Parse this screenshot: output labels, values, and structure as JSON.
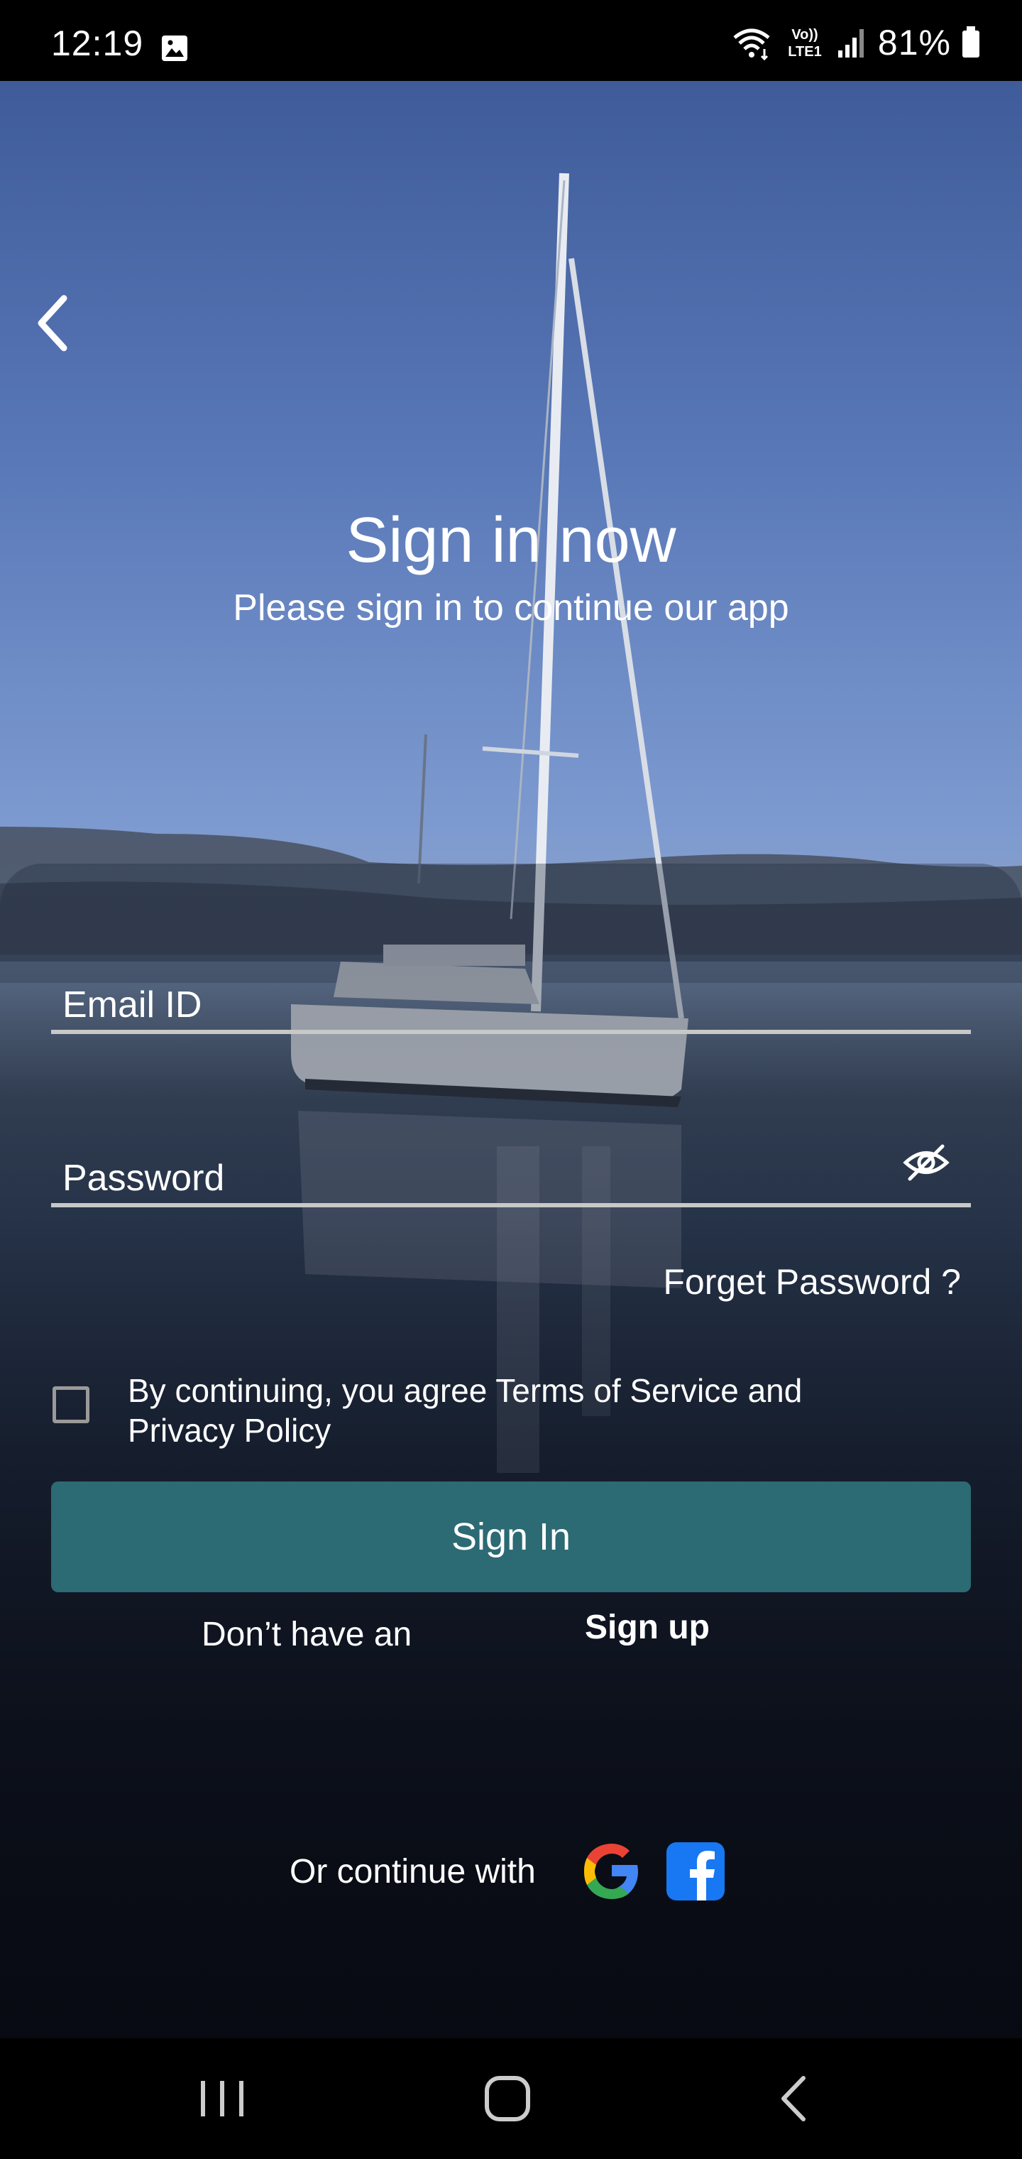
{
  "status_bar": {
    "time": "12:19",
    "battery": "81%",
    "network_label_top": "Vo))",
    "network_label_bottom": "LTE1"
  },
  "header": {
    "title": "Sign in now",
    "subtitle": "Please sign in to continue our app"
  },
  "form": {
    "email_placeholder": "Email ID",
    "email_value": "",
    "password_placeholder": "Password",
    "password_value": "",
    "forget_password": "Forget Password ?",
    "terms_text": "By continuing, you agree Terms of Service and Privacy Policy",
    "terms_checked": false,
    "signin_label": "Sign In",
    "signup_prompt": "Don’t have an",
    "signup_link": "Sign up",
    "continue_with": "Or continue with"
  },
  "icons": {
    "back": "chevron-left-icon",
    "eye": "eye-off-icon",
    "google": "google-icon",
    "facebook": "facebook-icon"
  },
  "colors": {
    "primary_button": "#2c6a74",
    "facebook_blue": "#1877f2"
  }
}
